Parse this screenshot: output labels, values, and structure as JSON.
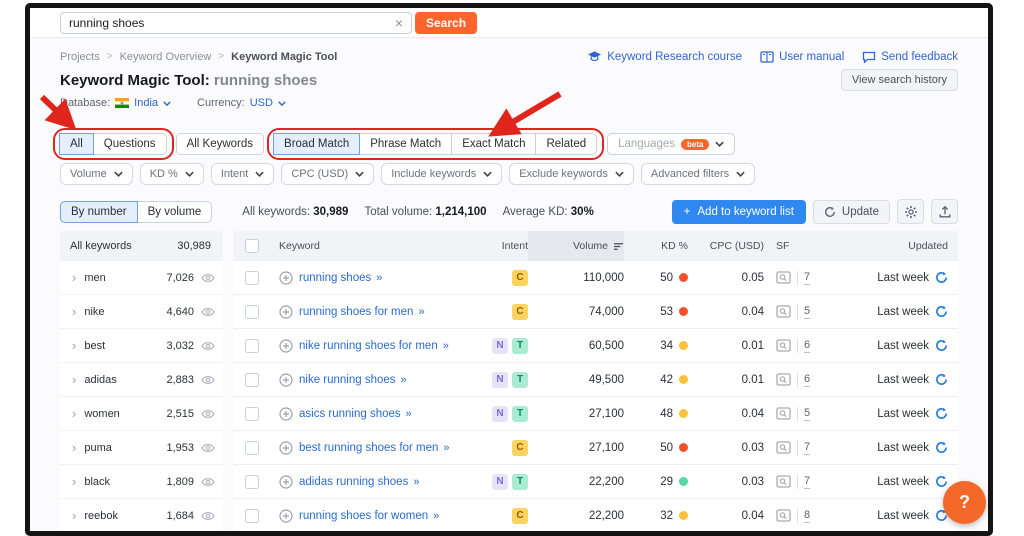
{
  "colors": {
    "brand_orange": "#ff642d",
    "link_blue": "#3064ce",
    "accent_blue": "#2f88f0",
    "annotation_red": "#e0261c",
    "kd_hard": "#f4502c",
    "kd_medium": "#fdc23c",
    "kd_easy": "#59d6a5"
  },
  "topbar": {
    "search_value": "running shoes",
    "search_button": "Search"
  },
  "breadcrumb": {
    "items": [
      "Projects",
      "Keyword Overview",
      "Keyword Magic Tool"
    ]
  },
  "header_links": [
    {
      "label": "Keyword Research course",
      "icon": "graduation-cap-icon"
    },
    {
      "label": "User manual",
      "icon": "book-icon"
    },
    {
      "label": "Send feedback",
      "icon": "chat-icon"
    }
  ],
  "page": {
    "title_prefix": "Keyword Magic Tool:",
    "title_query": "running shoes",
    "view_search_history": "View search history",
    "database_label": "Database:",
    "database_value": "India",
    "currency_label": "Currency:",
    "currency_value": "USD"
  },
  "tabs": {
    "question_group": [
      {
        "label": "All",
        "selected": true
      },
      {
        "label": "Questions",
        "selected": false
      }
    ],
    "all_keywords": "All Keywords",
    "match_group": [
      {
        "label": "Broad Match",
        "selected": true
      },
      {
        "label": "Phrase Match",
        "selected": false
      },
      {
        "label": "Exact Match",
        "selected": false
      },
      {
        "label": "Related",
        "selected": false
      }
    ],
    "languages": {
      "label": "Languages",
      "badge": "beta"
    }
  },
  "filters": [
    "Volume",
    "KD %",
    "Intent",
    "CPC (USD)",
    "Include keywords",
    "Exclude keywords",
    "Advanced filters"
  ],
  "toolbar": {
    "view_toggle": [
      {
        "label": "By number",
        "selected": true
      },
      {
        "label": "By volume",
        "selected": false
      }
    ],
    "stats": [
      {
        "label": "All keywords:",
        "value": "30,989"
      },
      {
        "label": "Total volume:",
        "value": "1,214,100"
      },
      {
        "label": "Average KD:",
        "value": "30%"
      }
    ],
    "add_button": "Add to keyword list",
    "update_button": "Update"
  },
  "sidebar": {
    "header_label": "All keywords",
    "header_count": "30,989",
    "items": [
      {
        "name": "men",
        "count": "7,026"
      },
      {
        "name": "nike",
        "count": "4,640"
      },
      {
        "name": "best",
        "count": "3,032"
      },
      {
        "name": "adidas",
        "count": "2,883"
      },
      {
        "name": "women",
        "count": "2,515"
      },
      {
        "name": "puma",
        "count": "1,953"
      },
      {
        "name": "black",
        "count": "1,809"
      },
      {
        "name": "reebok",
        "count": "1,684"
      }
    ]
  },
  "table": {
    "columns": {
      "keyword": "Keyword",
      "intent": "Intent",
      "volume": "Volume",
      "kd": "KD %",
      "cpc": "CPC (USD)",
      "sf": "SF",
      "updated": "Updated"
    },
    "intent_styles": {
      "C": {
        "bg": "#fbd35e",
        "fg": "#945e00"
      },
      "N": {
        "bg": "#e6e3f7",
        "fg": "#7a6ee0"
      },
      "T": {
        "bg": "#a9ecd3",
        "fg": "#0e8a68"
      }
    },
    "rows": [
      {
        "keyword": "running shoes",
        "intents": [
          "C"
        ],
        "volume": "110,000",
        "kd": "50",
        "kd_level": "hard",
        "cpc": "0.05",
        "sf": "7",
        "updated": "Last week"
      },
      {
        "keyword": "running shoes for men",
        "intents": [
          "C"
        ],
        "volume": "74,000",
        "kd": "53",
        "kd_level": "hard",
        "cpc": "0.04",
        "sf": "5",
        "updated": "Last week"
      },
      {
        "keyword": "nike running shoes for men",
        "intents": [
          "N",
          "T"
        ],
        "volume": "60,500",
        "kd": "34",
        "kd_level": "medium",
        "cpc": "0.01",
        "sf": "6",
        "updated": "Last week"
      },
      {
        "keyword": "nike running shoes",
        "intents": [
          "N",
          "T"
        ],
        "volume": "49,500",
        "kd": "42",
        "kd_level": "medium",
        "cpc": "0.01",
        "sf": "6",
        "updated": "Last week"
      },
      {
        "keyword": "asics running shoes",
        "intents": [
          "N",
          "T"
        ],
        "volume": "27,100",
        "kd": "48",
        "kd_level": "medium",
        "cpc": "0.04",
        "sf": "5",
        "updated": "Last week"
      },
      {
        "keyword": "best running shoes for men",
        "intents": [
          "C"
        ],
        "volume": "27,100",
        "kd": "50",
        "kd_level": "hard",
        "cpc": "0.03",
        "sf": "7",
        "updated": "Last week"
      },
      {
        "keyword": "adidas running shoes",
        "intents": [
          "N",
          "T"
        ],
        "volume": "22,200",
        "kd": "29",
        "kd_level": "easy",
        "cpc": "0.03",
        "sf": "7",
        "updated": "Last week"
      },
      {
        "keyword": "running shoes for women",
        "intents": [
          "C"
        ],
        "volume": "22,200",
        "kd": "32",
        "kd_level": "medium",
        "cpc": "0.04",
        "sf": "8",
        "updated": "Last week"
      }
    ]
  },
  "help_button": "?"
}
